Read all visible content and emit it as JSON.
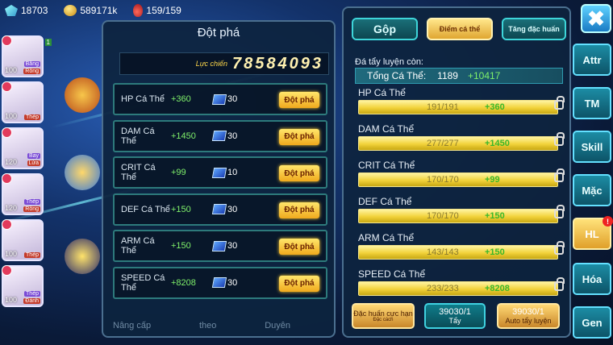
{
  "currencies": {
    "gems": "18703",
    "coins": "589171k",
    "potions": "159/159"
  },
  "roster": [
    {
      "level": "100",
      "types": [
        "Băng",
        "Rồng"
      ]
    },
    {
      "level": "100",
      "types": [
        "Thép"
      ]
    },
    {
      "level": "120",
      "types": [
        "Bay",
        "Lửa"
      ]
    },
    {
      "level": "120",
      "types": [
        "Thép",
        "Rồng"
      ]
    },
    {
      "level": "100",
      "types": [
        "Thép"
      ]
    },
    {
      "level": "100",
      "types": [
        "Thép",
        "Đánh"
      ]
    }
  ],
  "breakthrough": {
    "title": "Đột phá",
    "power_label": "Lực chiến",
    "power_value": "78584093",
    "button_label": "Đột phá",
    "rows": [
      {
        "stat": "HP Cá Thể",
        "bonus": "+360",
        "cost": "30"
      },
      {
        "stat": "DAM Cá Thể",
        "bonus": "+1450",
        "cost": "30"
      },
      {
        "stat": "CRIT Cá Thể",
        "bonus": "+99",
        "cost": "10"
      },
      {
        "stat": "DEF Cá Thể",
        "bonus": "+150",
        "cost": "30"
      },
      {
        "stat": "ARM Cá Thể",
        "bonus": "+150",
        "cost": "30"
      },
      {
        "stat": "SPEED Cá Thể",
        "bonus": "+8208",
        "cost": "30"
      }
    ],
    "bottom_tabs": [
      "Nâng cấp",
      "theo",
      "Duyên"
    ]
  },
  "training": {
    "tabs": [
      "Gộp",
      "Điểm cá thể",
      "Tăng đặc huấn"
    ],
    "remaining_label": "Đá tẩy luyện còn:",
    "total_label": "Tổng Cá Thể:",
    "total_value": "1189",
    "total_add": "+10417",
    "stats": [
      {
        "name": "HP Cá Thể",
        "current": "191/191",
        "add": "+360"
      },
      {
        "name": "DAM Cá Thể",
        "current": "277/277",
        "add": "+1450"
      },
      {
        "name": "CRIT Cá Thể",
        "current": "170/170",
        "add": "+99"
      },
      {
        "name": "DEF Cá Thể",
        "current": "170/170",
        "add": "+150"
      },
      {
        "name": "ARM Cá Thể",
        "current": "143/143",
        "add": "+150"
      },
      {
        "name": "SPEED Cá Thể",
        "current": "233/233",
        "add": "+8208"
      }
    ],
    "buttons": {
      "special": "Đặc huấn cực hạn",
      "special_sub": "Đặc cách",
      "wash_count": "39030/1",
      "wash_label": "Tẩy",
      "auto_count": "39030/1",
      "auto_label": "Auto tẩy luyện"
    }
  },
  "side_menu": {
    "close": "✖",
    "items": [
      "Attr",
      "TM",
      "Skill",
      "Mặc",
      "HL",
      "Hóa",
      "Gen"
    ],
    "hl_badge": "!"
  }
}
